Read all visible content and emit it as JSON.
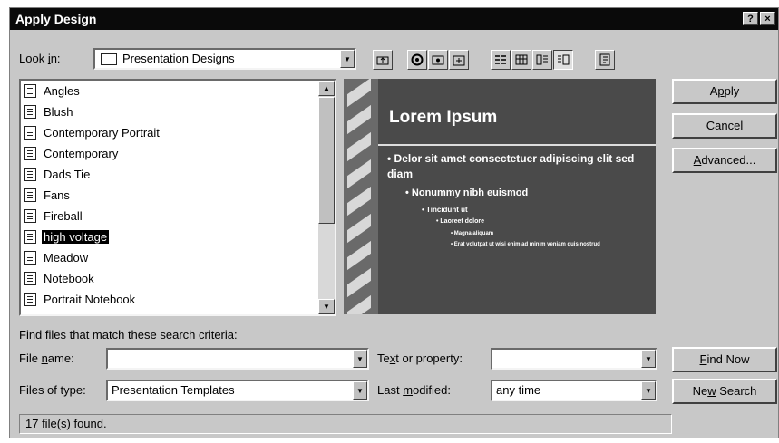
{
  "dialog": {
    "title": "Apply Design",
    "help_button": "?",
    "close_button": "×"
  },
  "lookin": {
    "label_pre": "Look ",
    "label_accel": "i",
    "label_post": "n:",
    "value": "Presentation Designs"
  },
  "toolbar": [
    {
      "name": "up-one-level-icon"
    },
    {
      "name": "search-web-icon"
    },
    {
      "name": "look-in-favorites-icon"
    },
    {
      "name": "add-to-favorites-icon"
    },
    {
      "name": "list-view-icon"
    },
    {
      "name": "details-view-icon"
    },
    {
      "name": "properties-view-icon"
    },
    {
      "name": "preview-view-icon"
    },
    {
      "name": "commands-settings-icon"
    }
  ],
  "files": {
    "items": [
      {
        "label": "Angles"
      },
      {
        "label": "Blush"
      },
      {
        "label": "Contemporary Portrait"
      },
      {
        "label": "Contemporary"
      },
      {
        "label": "Dads Tie"
      },
      {
        "label": "Fans"
      },
      {
        "label": "Fireball"
      },
      {
        "label": "high voltage"
      },
      {
        "label": "Meadow"
      },
      {
        "label": "Notebook"
      },
      {
        "label": "Portrait Notebook"
      }
    ],
    "selected_label": "high voltage"
  },
  "preview": {
    "title": "Lorem Ipsum",
    "bullet1": "• Delor sit amet consectetuer adipiscing elit sed diam",
    "bullet2": "• Nonummy nibh euismod",
    "bullet3": "• Tincidunt ut",
    "bullet4": "• Laoreet dolore",
    "bullet5": "• Magna aliquam",
    "bullet6": "• Erat volutpat ut wisi enim ad minim veniam quis nostrud"
  },
  "buttons": {
    "apply_accel": "p",
    "apply_pre": "A",
    "apply_post": "ply",
    "cancel": "Cancel",
    "advanced_accel": "A",
    "advanced_post": "dvanced...",
    "find_now_accel": "F",
    "find_now_post": "ind Now",
    "new_search_pre": "Ne",
    "new_search_accel": "w",
    "new_search_post": " Search"
  },
  "search": {
    "criteria_label": "Find files that match these search criteria:",
    "file_name_pre": "File ",
    "file_name_accel": "n",
    "file_name_post": "ame:",
    "file_name_value": "",
    "files_of_type_label": "Files of type:",
    "files_of_type_value": "Presentation Templates",
    "text_property_pre": "Te",
    "text_property_accel": "x",
    "text_property_post": "t or property:",
    "text_property_value": "",
    "last_modified_pre": "Last ",
    "last_modified_accel": "m",
    "last_modified_post": "odified:",
    "last_modified_value": "any time"
  },
  "status": {
    "text": "17 file(s) found."
  }
}
